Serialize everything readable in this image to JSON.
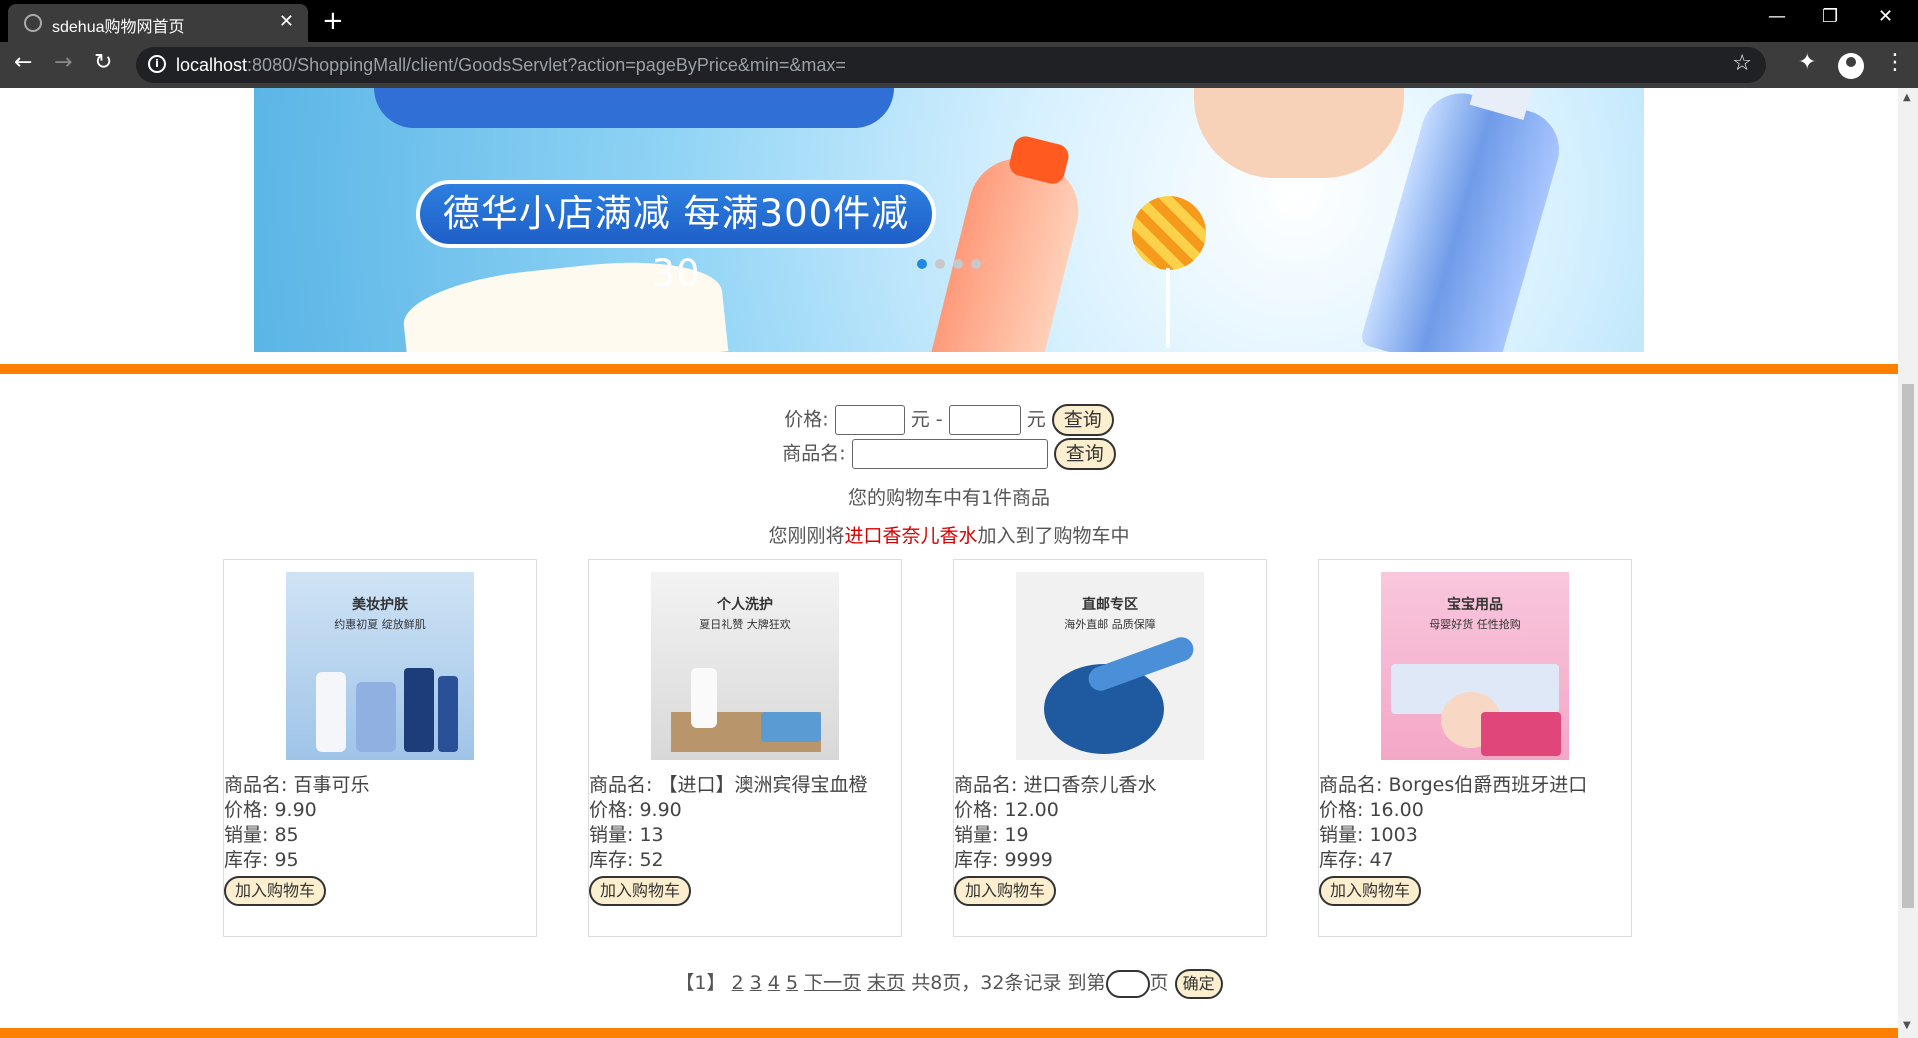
{
  "browser": {
    "tab_title": "sdehua购物网首页",
    "url_host": "localhost",
    "url_rest": ":8080/ShoppingMall/client/GoodsServlet?action=pageByPrice&min=&max="
  },
  "banner": {
    "promo_text": "德华小店满减 每满300件减30",
    "slide_count": 4,
    "active_slide": 1
  },
  "search": {
    "price_label": "价格:",
    "yuan": "元",
    "dash": "-",
    "query_label": "查询",
    "name_label": "商品名:"
  },
  "cart": {
    "count_text": "您的购物车中有1件商品",
    "added_prefix": "您刚刚将",
    "added_item": "进口香奈儿香水",
    "added_suffix": "加入到了购物车中"
  },
  "products": [
    {
      "img_title": "美妆护肤",
      "img_sub": "约惠初夏 绽放鲜肌",
      "name": "商品名: 百事可乐",
      "price": "价格: 9.90",
      "sales": "销量: 85",
      "stock": "库存: 95",
      "button": "加入购物车"
    },
    {
      "img_title": "个人洗护",
      "img_sub": "夏日礼赞 大牌狂欢",
      "name": "商品名: 【进口】澳洲宾得宝血橙",
      "price": "价格: 9.90",
      "sales": "销量: 13",
      "stock": "库存: 52",
      "button": "加入购物车"
    },
    {
      "img_title": "直邮专区",
      "img_sub": "海外直邮 品质保障",
      "name": "商品名: 进口香奈儿香水",
      "price": "价格: 12.00",
      "sales": "销量: 19",
      "stock": "库存: 9999",
      "button": "加入购物车"
    },
    {
      "img_title": "宝宝用品",
      "img_sub": "母婴好货 任性抢购",
      "name": "商品名: Borges伯爵西班牙进口",
      "price": "价格: 16.00",
      "sales": "销量: 1003",
      "stock": "库存: 47",
      "button": "加入购物车"
    }
  ],
  "pager": {
    "current": "【1】",
    "pages": [
      "2",
      "3",
      "4",
      "5"
    ],
    "next": "下一页",
    "last": "末页",
    "summary": "共8页，32条记录",
    "goto_prefix": "到第",
    "goto_suffix": "页",
    "ok": "确定"
  },
  "colors": {
    "accent_bar": "#ff8000",
    "highlight_text": "#d40000",
    "button_bg": "#fcefcf"
  }
}
